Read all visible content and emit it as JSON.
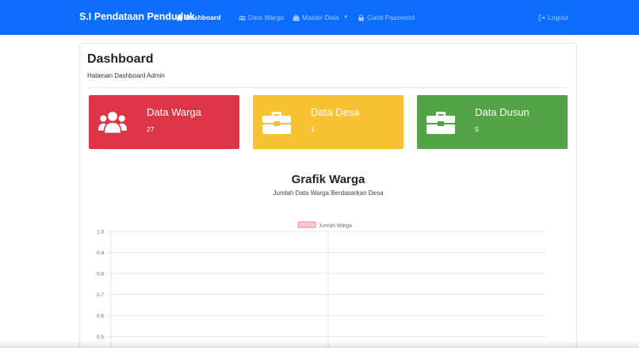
{
  "navbar": {
    "brand": "S.I Pendataan Penduduk",
    "items": [
      {
        "label": "Dashboard",
        "icon": "home-icon"
      },
      {
        "label": "Data Warga",
        "icon": "users-icon"
      },
      {
        "label": "Master Data",
        "icon": "database-icon"
      },
      {
        "label": "Ganti Password",
        "icon": "lock-icon"
      }
    ],
    "logout": {
      "label": "Logout",
      "icon": "logout-icon"
    },
    "color": "#0d6efd"
  },
  "page": {
    "title": "Dashboard",
    "subtitle": "Halaman Dashboard Admin"
  },
  "stats": [
    {
      "label": "Data Warga",
      "value": "27",
      "icon": "users-icon",
      "color": "#dc3545"
    },
    {
      "label": "Data Desa",
      "value": "1",
      "icon": "briefcase-icon",
      "color": "#f8c234"
    },
    {
      "label": "Data Dusun",
      "value": "5",
      "icon": "briefcase-icon",
      "color": "#52a444"
    }
  ],
  "chart": {
    "title": "Grafik Warga",
    "subtitle": "Jumlah Data Warga Berdasarkan Desa"
  },
  "chart_data": {
    "type": "bar",
    "categories": [],
    "series": [
      {
        "name": "Jumlah Warga",
        "values": []
      }
    ],
    "y_ticks": [
      "1.0",
      "0.9",
      "0.8",
      "0.7",
      "0.6",
      "0.5"
    ],
    "ylim": [
      0,
      1
    ],
    "legend": "top-center",
    "grid": true,
    "legend_color": "#f7c6cf"
  }
}
